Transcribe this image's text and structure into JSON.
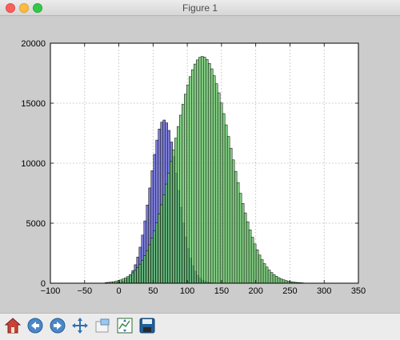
{
  "window": {
    "title": "Figure 1"
  },
  "toolbar": {
    "buttons": [
      {
        "name": "home-button",
        "icon": "home-icon"
      },
      {
        "name": "back-button",
        "icon": "back-arrow-icon"
      },
      {
        "name": "forward-button",
        "icon": "forward-arrow-icon"
      },
      {
        "name": "pan-button",
        "icon": "pan-move-icon"
      },
      {
        "name": "zoom-button",
        "icon": "zoom-rect-icon"
      },
      {
        "name": "subplots-button",
        "icon": "subplots-config-icon"
      },
      {
        "name": "save-button",
        "icon": "save-floppy-icon"
      }
    ]
  },
  "chart_data": {
    "type": "bar",
    "xlim": [
      -100,
      350
    ],
    "ylim": [
      0,
      20000
    ],
    "xticks": [
      -100,
      -50,
      0,
      50,
      100,
      150,
      200,
      250,
      300,
      350
    ],
    "yticks": [
      0,
      5000,
      10000,
      15000,
      20000
    ],
    "grid": true,
    "bin_width": 3.5,
    "series": [
      {
        "color": "#5050c8",
        "mean": 66,
        "sd": 20,
        "peak": 13600,
        "x_range": [
          -30,
          160
        ]
      },
      {
        "color": "#5cc05c",
        "mean": 122,
        "sd": 41,
        "peak": 18900,
        "x_range": [
          -20,
          270
        ]
      }
    ]
  }
}
